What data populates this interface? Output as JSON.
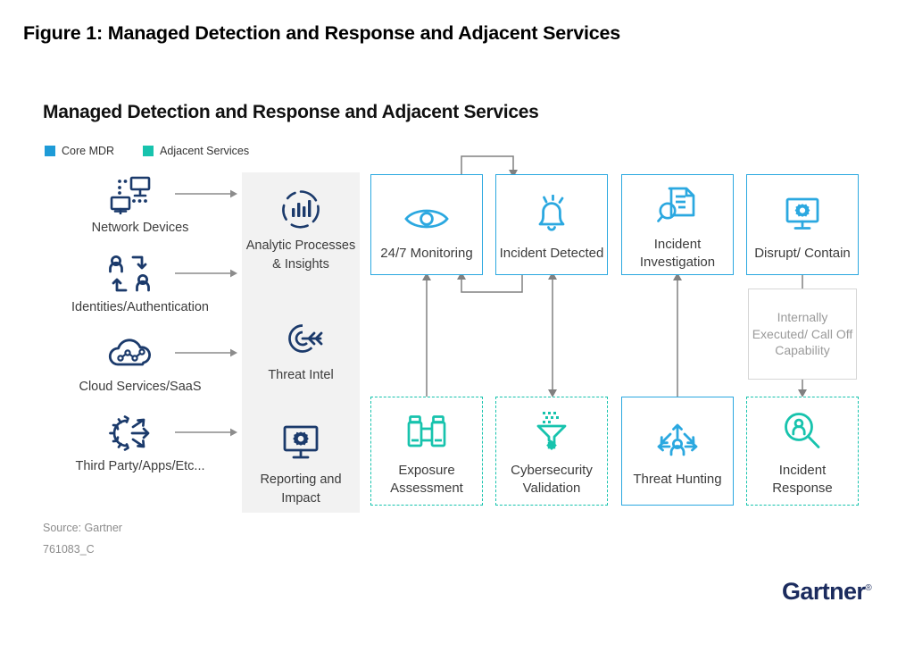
{
  "figure": {
    "title": "Figure 1: Managed Detection and Response and Adjacent Services",
    "subtitle": "Managed Detection and Response and Adjacent Services"
  },
  "legend": {
    "items": [
      {
        "label": "Core MDR",
        "color": "#1E9BD7",
        "icon": "square-swatch-icon"
      },
      {
        "label": "Adjacent Services",
        "color": "#17C3AD",
        "icon": "square-swatch-icon"
      }
    ]
  },
  "sources": {
    "items": [
      {
        "label": "Network Devices",
        "icon": "network-devices-icon"
      },
      {
        "label": "Identities/Authentication",
        "icon": "identities-authentication-icon"
      },
      {
        "label": "Cloud Services/SaaS",
        "icon": "cloud-services-icon"
      },
      {
        "label": "Third Party/Apps/Etc...",
        "icon": "third-party-apps-icon"
      }
    ],
    "arrow_color": "#8c8c8c",
    "icon_color": "#1B3A6B"
  },
  "capabilities_panel": {
    "background": "#f2f2f2",
    "items": [
      {
        "label": "Analytic Processes & Insights",
        "icon": "analytics-chart-icon"
      },
      {
        "label": "Threat Intel",
        "icon": "target-arrow-icon"
      },
      {
        "label": "Reporting and Impact",
        "icon": "monitor-gear-icon"
      }
    ]
  },
  "process": {
    "core_color": "#2BA8E0",
    "adjacent_color": "#17C3AD",
    "top_row": [
      {
        "label": "24/7 Monitoring",
        "icon": "eye-icon",
        "type": "core"
      },
      {
        "label": "Incident Detected",
        "icon": "alert-bell-icon",
        "type": "core"
      },
      {
        "label": "Incident Investigation",
        "icon": "document-magnifier-icon",
        "type": "core"
      },
      {
        "label": "Disrupt/ Contain",
        "icon": "monitor-gear-icon",
        "type": "core"
      }
    ],
    "bottom_row": [
      {
        "label": "Exposure Assessment",
        "icon": "binoculars-icon",
        "type": "adjacent"
      },
      {
        "label": "Cybersecurity Validation",
        "icon": "funnel-bug-icon",
        "type": "adjacent"
      },
      {
        "label": "Threat Hunting",
        "icon": "threat-hunting-icon",
        "type": "core"
      },
      {
        "label": "Incident Response",
        "icon": "person-magnifier-icon",
        "type": "adjacent"
      }
    ],
    "middle_box": {
      "label": "Internally Executed/ Call Off Capability",
      "border_color": "#d6d6d6",
      "text_color": "#9a9a9a"
    }
  },
  "footer": {
    "source": "Source: Gartner",
    "id": "761083_C",
    "logo": "Gartner",
    "logo_color": "#1B2B5E"
  }
}
